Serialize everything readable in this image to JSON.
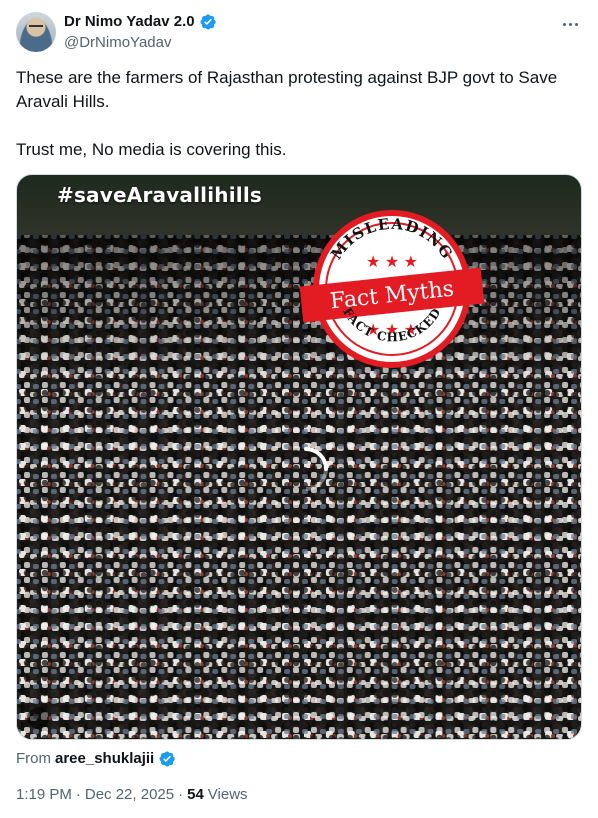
{
  "author": {
    "display_name": "Dr Nimo Yadav 2.0",
    "handle": "@DrNimoYadav",
    "avatar_icon": "person-avatar",
    "verified_color": "#1d9bf0"
  },
  "tweet": {
    "line1": "These are the farmers of Rajasthan protesting against BJP govt to Save Aravali Hills.",
    "line2": "Trust me, No media is covering this."
  },
  "media": {
    "overlay_hashtag": "#saveAravallihills",
    "stamp": {
      "top_text": "MISLEADING",
      "banner_text": "Fact Myths",
      "bottom_text": "FACT CHECKED",
      "color": "#e31b23"
    }
  },
  "source": {
    "prefix": "From",
    "username": "aree_shuklajii"
  },
  "meta": {
    "time": "1:19 PM",
    "separator1": "·",
    "date": "Dec 22, 2025",
    "separator2": "·",
    "views_count": "54",
    "views_label": "Views"
  },
  "colors": {
    "text_primary": "#0f1419",
    "text_secondary": "#536471",
    "accent": "#1d9bf0"
  }
}
